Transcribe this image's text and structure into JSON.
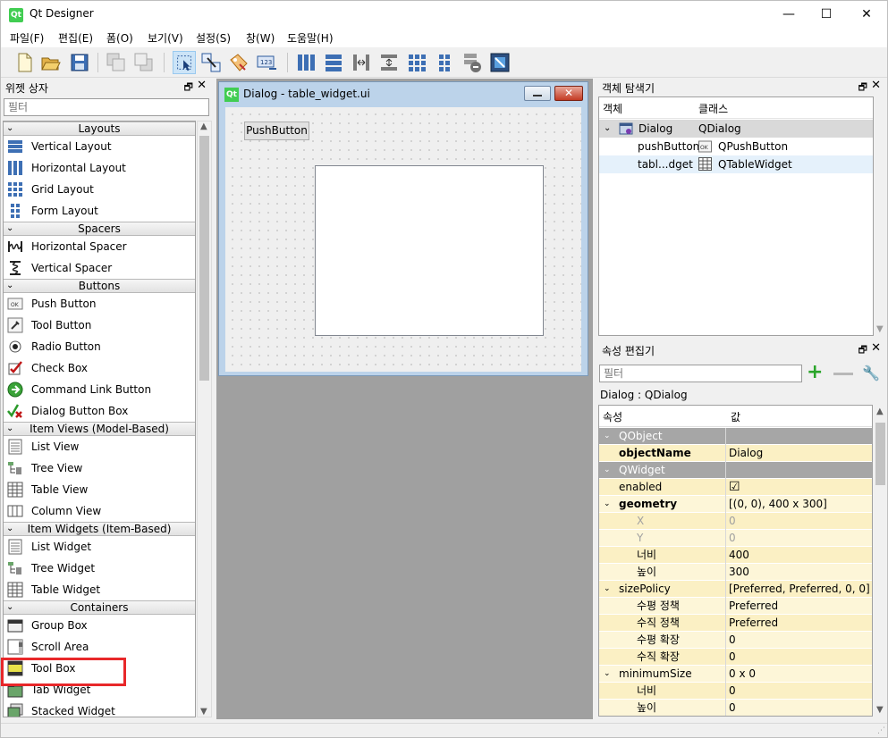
{
  "window": {
    "title": "Qt Designer",
    "app_icon": "Qt",
    "minimize": "—",
    "maximize": "☐",
    "close": "✕"
  },
  "menubar": [
    "파일(F)",
    "편집(E)",
    "폼(O)",
    "보기(V)",
    "설정(S)",
    "창(W)",
    "도움말(H)"
  ],
  "toolbar_icons": [
    "new-form-icon",
    "open-form-icon",
    "save-form-icon",
    "send-to-back-icon",
    "bring-to-front-icon",
    "edit-widgets-icon",
    "edit-signals-slots-icon",
    "edit-buddies-icon",
    "edit-tab-order-icon",
    "lay-out-horizontally-icon",
    "lay-out-vertically-icon",
    "lay-out-horizontal-splitter-icon",
    "lay-out-vertical-splitter-icon",
    "lay-out-grid-icon",
    "lay-out-form-icon",
    "break-layout-icon",
    "adjust-size-icon"
  ],
  "widget_box": {
    "title": "위젯 상자",
    "filter_placeholder": "필터",
    "categories": [
      {
        "name": "Layouts",
        "items": [
          "Vertical Layout",
          "Horizontal Layout",
          "Grid Layout",
          "Form Layout"
        ]
      },
      {
        "name": "Spacers",
        "items": [
          "Horizontal Spacer",
          "Vertical Spacer"
        ]
      },
      {
        "name": "Buttons",
        "items": [
          "Push Button",
          "Tool Button",
          "Radio Button",
          "Check Box",
          "Command Link Button",
          "Dialog Button Box"
        ]
      },
      {
        "name": "Item Views (Model-Based)",
        "items": [
          "List View",
          "Tree View",
          "Table View",
          "Column View"
        ]
      },
      {
        "name": "Item Widgets (Item-Based)",
        "items": [
          "List Widget",
          "Tree Widget",
          "Table Widget"
        ]
      },
      {
        "name": "Containers",
        "items": [
          "Group Box",
          "Scroll Area",
          "Tool Box",
          "Tab Widget",
          "Stacked Widget"
        ]
      }
    ],
    "highlighted_item": "Table Widget",
    "highlight_color": "#e8282a"
  },
  "form": {
    "title": "Dialog - table_widget.ui",
    "icon": "Qt",
    "push_button_label": "PushButton",
    "close_glyph": "✕"
  },
  "object_inspector": {
    "title": "객체 탐색기",
    "col_object": "객체",
    "col_class": "클래스",
    "rows": [
      {
        "object": "Dialog",
        "class": "QDialog",
        "expander": "⌄"
      },
      {
        "object": "pushButton",
        "class": "QPushButton"
      },
      {
        "object": "tabl...dget",
        "class": "QTableWidget"
      }
    ]
  },
  "property_editor": {
    "title": "속성 편집기",
    "filter_placeholder": "필터",
    "class_label": "Dialog : QDialog",
    "col_property": "속성",
    "col_value": "값",
    "rows": [
      {
        "name": "QObject",
        "value": "",
        "type": "group"
      },
      {
        "name": "objectName",
        "value": "Dialog",
        "bold": true
      },
      {
        "name": "QWidget",
        "value": "",
        "type": "group"
      },
      {
        "name": "enabled",
        "value": "☑"
      },
      {
        "name": "geometry",
        "value": "[(0, 0), 400 x 300]",
        "bold": true,
        "expander": "⌄"
      },
      {
        "name": "X",
        "value": "0",
        "sub": true,
        "disabled": true
      },
      {
        "name": "Y",
        "value": "0",
        "sub": true,
        "disabled": true
      },
      {
        "name": "너비",
        "value": "400",
        "sub": true
      },
      {
        "name": "높이",
        "value": "300",
        "sub": true
      },
      {
        "name": "sizePolicy",
        "value": "[Preferred, Preferred, 0, 0]",
        "expander": "⌄"
      },
      {
        "name": "수평 정책",
        "value": "Preferred",
        "sub": true
      },
      {
        "name": "수직 정책",
        "value": "Preferred",
        "sub": true
      },
      {
        "name": "수평 확장",
        "value": "0",
        "sub": true
      },
      {
        "name": "수직 확장",
        "value": "0",
        "sub": true
      },
      {
        "name": "minimumSize",
        "value": "0 x 0",
        "expander": "⌄"
      },
      {
        "name": "너비",
        "value": "0",
        "sub": true
      },
      {
        "name": "높이",
        "value": "0",
        "sub": true
      }
    ]
  }
}
